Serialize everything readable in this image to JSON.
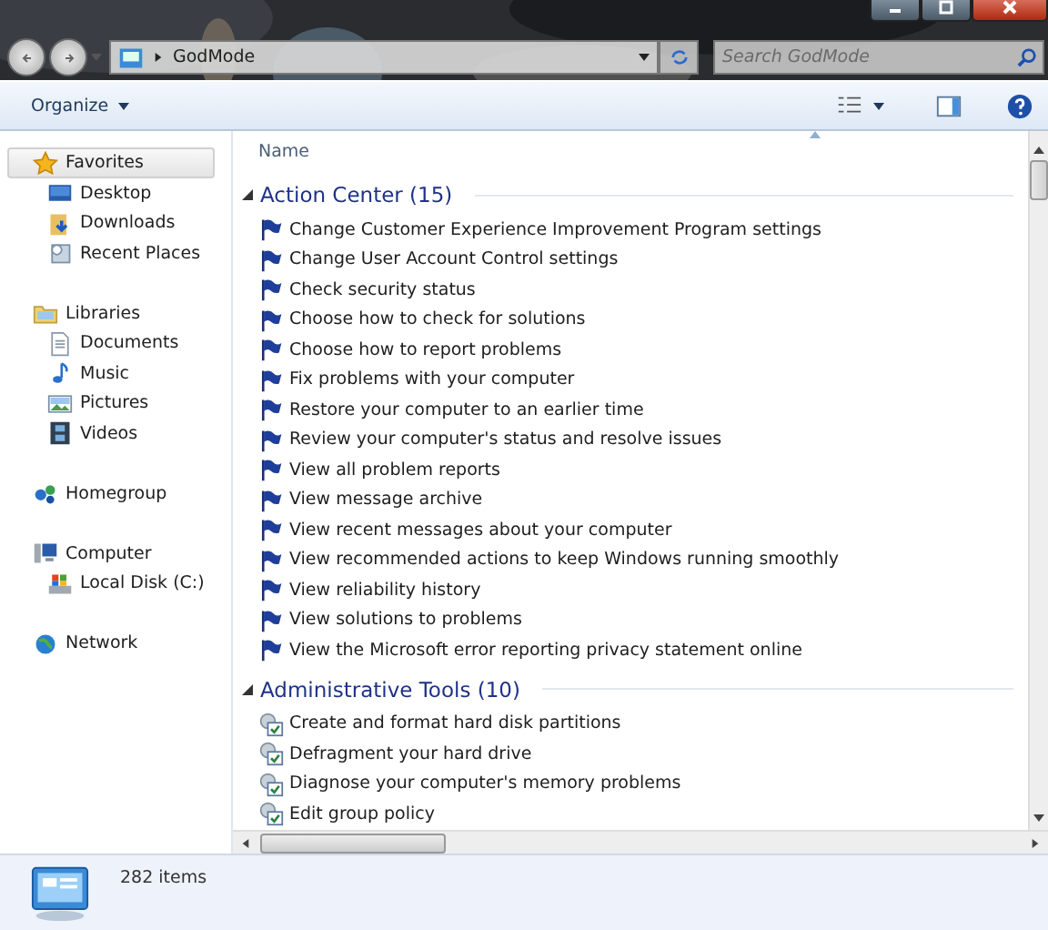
{
  "address_bar": {
    "path": "GodMode"
  },
  "search": {
    "placeholder": "Search GodMode"
  },
  "toolbar": {
    "organize": "Organize"
  },
  "sidebar": {
    "sections": [
      {
        "label": "Favorites",
        "selected": true,
        "children": [
          {
            "label": "Desktop",
            "selected": false
          },
          {
            "label": "Downloads",
            "selected": false
          },
          {
            "label": "Recent Places",
            "selected": false
          }
        ]
      },
      {
        "label": "Libraries",
        "selected": false,
        "children": [
          {
            "label": "Documents",
            "selected": false
          },
          {
            "label": "Music",
            "selected": false
          },
          {
            "label": "Pictures",
            "selected": false
          },
          {
            "label": "Videos",
            "selected": false
          }
        ]
      },
      {
        "label": "Homegroup",
        "selected": false
      },
      {
        "label": "Computer",
        "selected": false,
        "children": [
          {
            "label": "Local Disk (C:)",
            "selected": false
          }
        ]
      },
      {
        "label": "Network",
        "selected": false
      }
    ]
  },
  "list": {
    "column": "Name",
    "groups": [
      {
        "title": "Action Center (15)",
        "expanded": true,
        "kind": "flag",
        "items": [
          "Change Customer Experience Improvement Program settings",
          "Change User Account Control settings",
          "Check security status",
          "Choose how to check for solutions",
          "Choose how to report problems",
          "Fix problems with your computer",
          "Restore your computer to an earlier time",
          "Review your computer's status and resolve issues",
          "View all problem reports",
          "View message archive",
          "View recent messages about your computer",
          "View recommended actions to keep Windows running smoothly",
          "View reliability history",
          "View solutions to problems",
          "View the Microsoft error reporting privacy statement online"
        ]
      },
      {
        "title": "Administrative Tools (10)",
        "expanded": true,
        "kind": "tool",
        "items": [
          "Create and format hard disk partitions",
          "Defragment your hard drive",
          "Diagnose your computer's memory problems",
          "Edit group policy"
        ]
      }
    ]
  },
  "details": {
    "count": "282 items"
  }
}
